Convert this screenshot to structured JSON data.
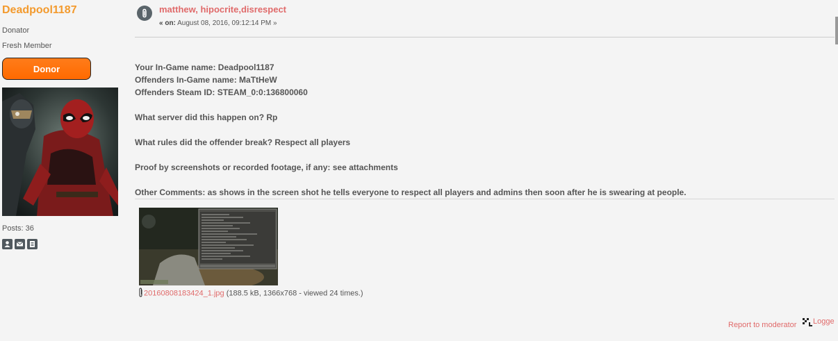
{
  "poster": {
    "name": "Deadpool1187",
    "group": "Donator",
    "rank": "Fresh Member",
    "badge": "Donor",
    "posts": "Posts: 36",
    "icons": [
      "profile-icon",
      "email-icon",
      "posts-icon"
    ]
  },
  "message": {
    "icon": "paperclip-icon",
    "subject": "matthew, hipocrite,disrespect",
    "date_prefix": "« on:",
    "date": "August 08, 2016, 09:12:14 PM »",
    "lines": [
      "Your In-Game name: Deadpool1187",
      "Offenders In-Game name: MaTtHeW",
      "Offenders Steam ID: STEAM_0:0:136800060",
      "",
      "What server did this happen on? Rp",
      "",
      "What rules did the offender break? Respect all players",
      "",
      "Proof by screenshots or recorded footage, if any: see attachments",
      "",
      "Other Comments: as shows in the screen shot he tells everyone to respect all players and admins then soon after he is swearing at people."
    ]
  },
  "attachment": {
    "filename": "20160808183424_1.jpg",
    "meta": "(188.5 kB, 1366x768 - viewed 24 times.)"
  },
  "footer": {
    "report": "Report to moderator",
    "logged": "Logge"
  }
}
